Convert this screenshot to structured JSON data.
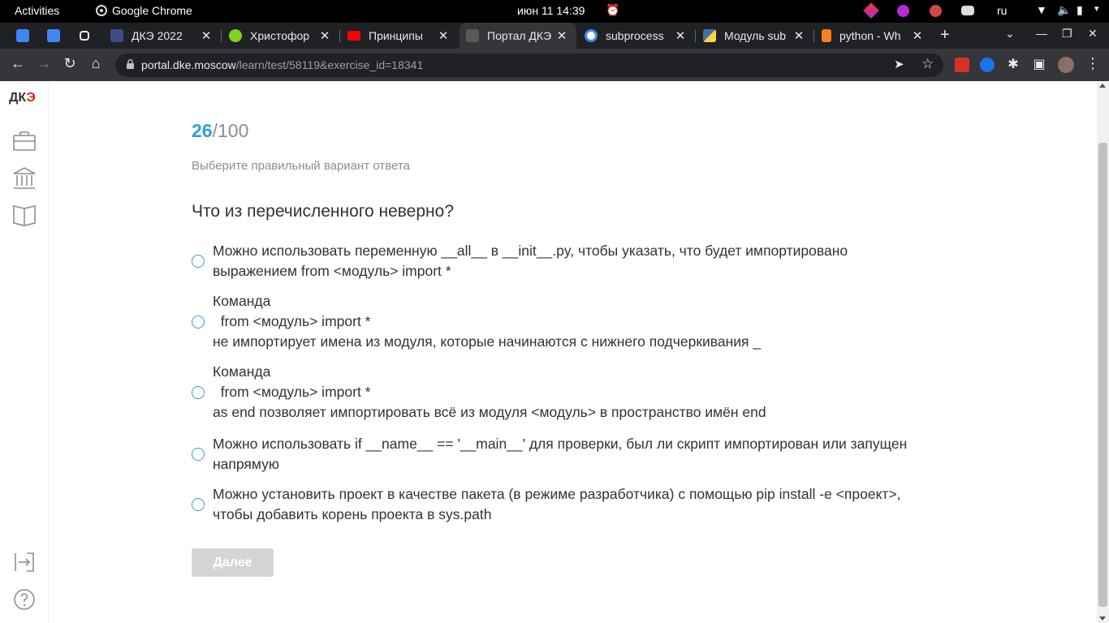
{
  "os": {
    "activities": "Activities",
    "app_name": "Google Chrome",
    "clock": "июн 11  14:39",
    "lang": "ru"
  },
  "tabs": [
    {
      "title": "",
      "favicon": "docs-icon",
      "color": "#4285f4"
    },
    {
      "title": "",
      "favicon": "docs-icon",
      "color": "#4285f4"
    },
    {
      "title": "",
      "favicon": "link-icon",
      "color": "#e8eaed"
    },
    {
      "title": "ДКЭ 2022",
      "favicon": "dke-icon",
      "color": "#3c4b8a"
    },
    {
      "title": "Христофор",
      "favicon": "circle-icon",
      "color": "#7ed321"
    },
    {
      "title": "Принципы",
      "favicon": "youtube-icon",
      "color": "#ff0000"
    },
    {
      "title": "Портал ДКЭ",
      "favicon": "portal-icon",
      "color": "#5a5a5a",
      "active": true
    },
    {
      "title": "subprocess",
      "favicon": "google-icon",
      "color": "#ffffff"
    },
    {
      "title": "Модуль sub",
      "favicon": "python-icon",
      "color": "#3776ab"
    },
    {
      "title": "python - Wh",
      "favicon": "stackoverflow-icon",
      "color": "#f48024"
    }
  ],
  "address": {
    "host": "portal.dke.moscow",
    "path": "/learn/test/58119&exercise_id=18341"
  },
  "logo": {
    "text_a": "ДК",
    "text_b": "Э"
  },
  "test": {
    "current": "26",
    "total": "/100",
    "instruction": "Выберите правильный вариант ответа",
    "question": "Что из перечисленного неверно?",
    "options": [
      "Можно использовать переменную __all__ в __init__.py, чтобы указать, что будет импортировано выражением from <модуль> import *",
      "Команда\n  from <модуль> import *\nне импортирует имена из модуля, которые начинаются с нижнего подчеркивания _",
      "Команда\n  from <модуль> import *\nas end позволяет импортировать всё из модуля <модуль> в пространство имён end",
      "Можно использовать if __name__ == '__main__' для проверки, был ли скрипт импортирован или запущен напрямую",
      "Можно установить проект в качестве пакета (в режиме разработчика) с помощью pip install -e <проект>, чтобы добавить корень проекта в sys.path"
    ],
    "next_label": "Далее"
  },
  "colors": {
    "accent": "#2ea0d6",
    "muted": "#8a8f94",
    "disabled_button": "#d3d5d6"
  }
}
